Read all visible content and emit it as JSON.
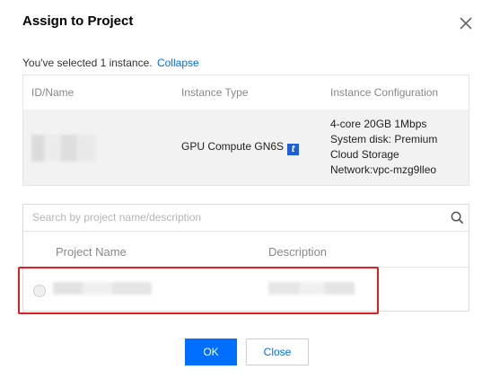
{
  "dialog": {
    "title": "Assign to Project",
    "selected_text": "You've selected 1 instance.",
    "collapse_link": "Collapse"
  },
  "instance_table": {
    "headers": [
      "ID/Name",
      "Instance Type",
      "Instance Configuration"
    ],
    "row": {
      "type": "GPU Compute GN6S",
      "type_badge": "t",
      "config_lines": [
        "4-core 20GB 1Mbps",
        "System disk: Premium",
        "Cloud Storage",
        "Network:vpc-mzg9lleo"
      ]
    }
  },
  "project_table": {
    "search_placeholder": "Search by project name/description",
    "headers": [
      "Project Name",
      "Description"
    ]
  },
  "buttons": {
    "ok": "OK",
    "close": "Close"
  },
  "colors": {
    "primary": "#006eff",
    "highlight": "#e02020",
    "badge": "#1e5fd8"
  },
  "icons": {
    "close": "close-icon",
    "search": "search-icon"
  }
}
